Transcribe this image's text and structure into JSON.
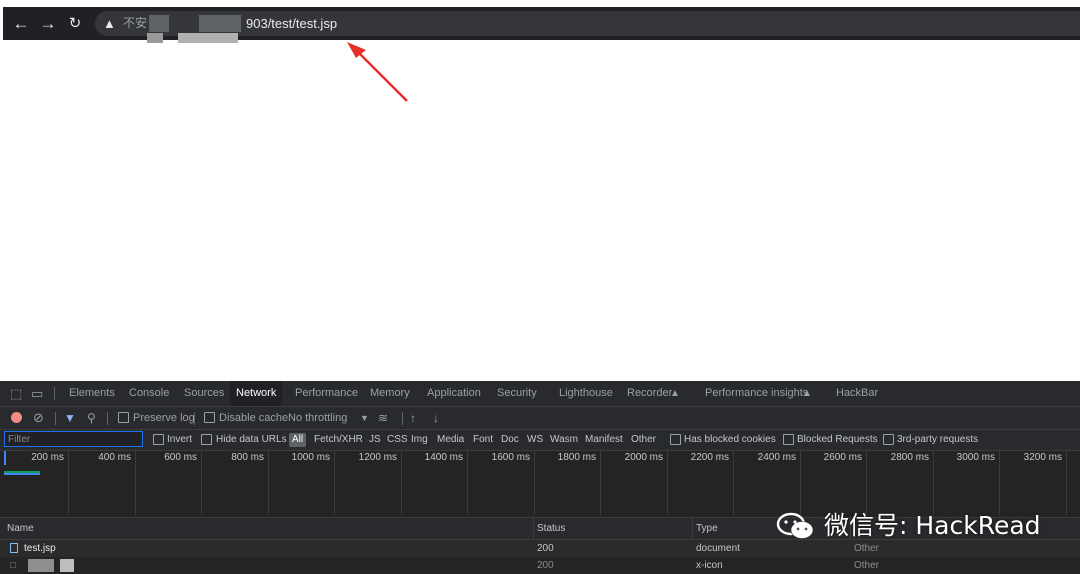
{
  "browser": {
    "insecure_label": "不安",
    "url_suffix": "903/test/test.jsp"
  },
  "devtools": {
    "tabs": [
      "Elements",
      "Console",
      "Sources",
      "Network",
      "Performance",
      "Memory",
      "Application",
      "Security",
      "Lighthouse",
      "Recorder",
      "Performance insights",
      "HackBar"
    ],
    "active_tab": "Network",
    "toolbar": {
      "preserve_log": "Preserve log",
      "disable_cache": "Disable cache",
      "throttling": "No throttling"
    },
    "filter": {
      "placeholder": "Filter",
      "invert": "Invert",
      "hide_data_urls": "Hide data URLs",
      "all": "All",
      "types": [
        "Fetch/XHR",
        "JS",
        "CSS",
        "Img",
        "Media",
        "Font",
        "Doc",
        "WS",
        "Wasm",
        "Manifest",
        "Other"
      ],
      "has_blocked_cookies": "Has blocked cookies",
      "blocked_requests": "Blocked Requests",
      "third_party": "3rd-party requests"
    },
    "overview_ticks": [
      "200 ms",
      "400 ms",
      "600 ms",
      "800 ms",
      "1000 ms",
      "1200 ms",
      "1400 ms",
      "1600 ms",
      "1800 ms",
      "2000 ms",
      "2200 ms",
      "2400 ms",
      "2600 ms",
      "2800 ms",
      "3000 ms",
      "3200 ms"
    ],
    "columns": {
      "name": "Name",
      "status": "Status",
      "type": "Type"
    },
    "rows": [
      {
        "name": "test.jsp",
        "status": "200",
        "type": "document",
        "initiator": "Other"
      },
      {
        "name": "",
        "status": "200",
        "type": "x-icon",
        "initiator": "Other"
      }
    ]
  },
  "watermark": "微信号: HackRead",
  "colors": {
    "arrow": "#e8302a",
    "devtools_bg": "#242424",
    "accent_blue": "#1a73e8"
  }
}
